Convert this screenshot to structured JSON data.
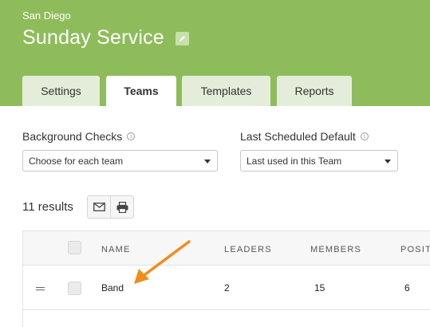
{
  "header": {
    "campus": "San Diego",
    "title": "Sunday Service",
    "edit_icon": "pencil-icon",
    "color": "#8ebc5a"
  },
  "tabs": [
    {
      "label": "Settings",
      "active": false
    },
    {
      "label": "Teams",
      "active": true
    },
    {
      "label": "Templates",
      "active": false
    },
    {
      "label": "Reports",
      "active": false
    }
  ],
  "filters": {
    "background_checks": {
      "label": "Background Checks",
      "value": "Choose for each team",
      "info_icon": "info-icon"
    },
    "last_scheduled": {
      "label": "Last Scheduled Default",
      "value": "Last used in this Team",
      "info_icon": "info-icon"
    }
  },
  "results": {
    "count_text": "11 results",
    "mail_icon": "envelope-icon",
    "print_icon": "printer-icon"
  },
  "table": {
    "columns": [
      "NAME",
      "LEADERS",
      "MEMBERS",
      "POSITI"
    ],
    "rows": [
      {
        "name": "Band",
        "leaders": "2",
        "members": "15",
        "positions": "6"
      }
    ]
  },
  "annotation": {
    "arrow_color": "#f28c1c",
    "points_to": "Band"
  }
}
